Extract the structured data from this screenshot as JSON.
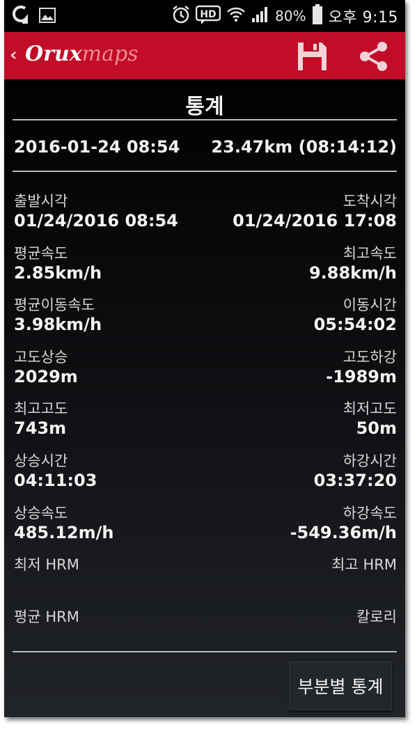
{
  "status_bar": {
    "battery_percent": "80%",
    "time": "오후 9:15",
    "icons": [
      "app-notification-icon",
      "image-icon",
      "alarm-icon",
      "hd-voice-icon",
      "wifi-icon",
      "signal-icon",
      "battery-icon"
    ]
  },
  "header": {
    "logo_part1": "Orux",
    "logo_part2": "maps",
    "back_icon": "chevron-left-icon",
    "save_icon": "save-icon",
    "share_icon": "share-icon",
    "accent_color": "#c10d27"
  },
  "screen": {
    "title": "통계"
  },
  "summary": {
    "start_datetime": "2016-01-24 08:54",
    "distance_time": "23.47km (08:14:12)"
  },
  "stats": [
    {
      "left_label": "출발시각",
      "left_value": "01/24/2016 08:54",
      "right_label": "도착시각",
      "right_value": "01/24/2016 17:08"
    },
    {
      "left_label": "평균속도",
      "left_value": "2.85km/h",
      "right_label": "최고속도",
      "right_value": "9.88km/h"
    },
    {
      "left_label": "평균이동속도",
      "left_value": "3.98km/h",
      "right_label": "이동시간",
      "right_value": "05:54:02"
    },
    {
      "left_label": "고도상승",
      "left_value": "2029m",
      "right_label": "고도하강",
      "right_value": "-1989m"
    },
    {
      "left_label": "최고고도",
      "left_value": "743m",
      "right_label": "최저고도",
      "right_value": "50m"
    },
    {
      "left_label": "상승시간",
      "left_value": "04:11:03",
      "right_label": "하강시간",
      "right_value": "03:37:20"
    },
    {
      "left_label": "상승속도",
      "left_value": "485.12m/h",
      "right_label": "하강속도",
      "right_value": "-549.36m/h"
    },
    {
      "left_label": "최저 HRM",
      "left_value": "",
      "right_label": "최고 HRM",
      "right_value": ""
    },
    {
      "left_label": "평균 HRM",
      "left_value": "",
      "right_label": "칼로리",
      "right_value": ""
    }
  ],
  "actions": {
    "segment_stats_label": "부분별 통계"
  }
}
